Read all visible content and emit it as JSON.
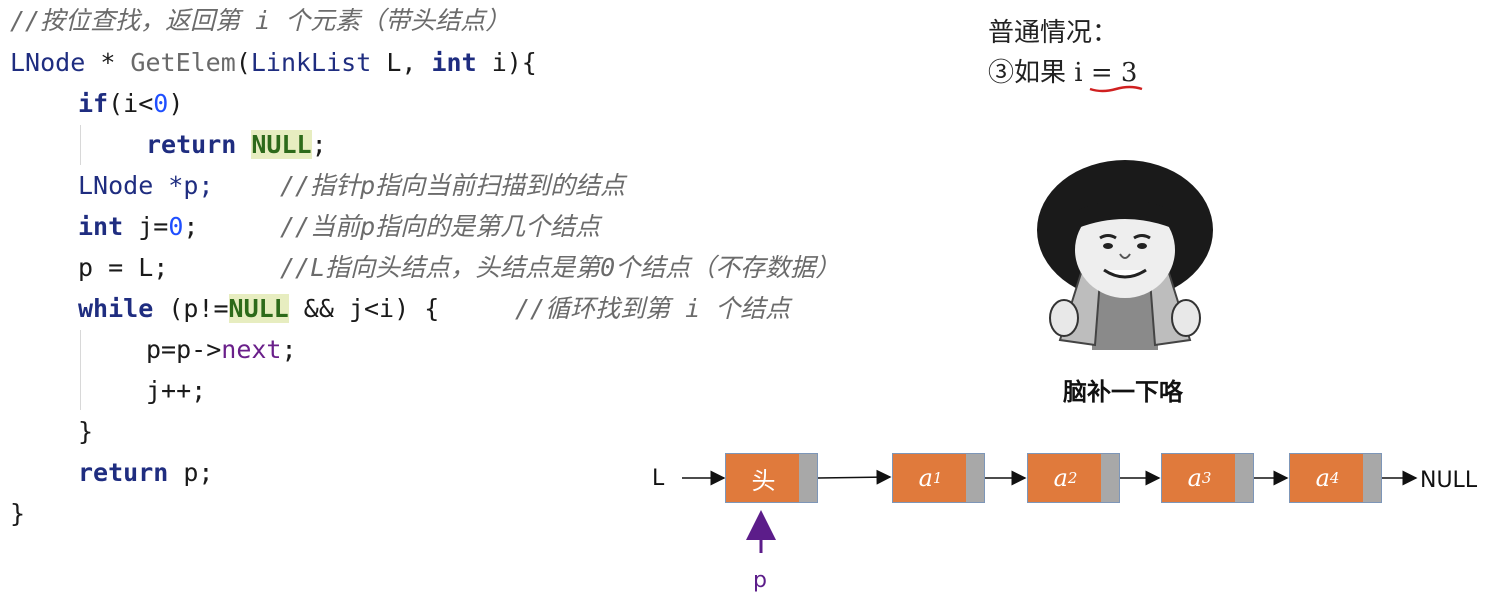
{
  "code": {
    "comment_title": "//按位查找，返回第 i 个元素（带头结点）",
    "sig_type": "LNode",
    "sig_star": " * ",
    "sig_fn": "GetElem",
    "sig_open": "(",
    "sig_param_type": "LinkList",
    "sig_param_L": " L, ",
    "sig_int": "int",
    "sig_rest": " i){",
    "if_kw": "if",
    "if_cond1": "(i<",
    "if_zero": "0",
    "if_close": ")",
    "return_kw": "return",
    "null_1": "NULL",
    "semicolon": ";",
    "decl_p": "LNode *p;",
    "comment_p": "//指针p指向当前扫描到的结点",
    "int_kw": "int",
    "decl_j1": " j=",
    "zero": "0",
    "decl_j2": ";",
    "comment_j": "//当前p指向的是第几个结点",
    "assign_p": "p = L;",
    "comment_L": "//L指向头结点，头结点是第0个结点（不存数据）",
    "while_kw": "while",
    "while_1": " (p!=",
    "null_2": "NULL",
    "while_2": " && j<i) {",
    "comment_while": "//循环找到第 i 个结点",
    "next_1": "p=p->",
    "next_field": "next",
    "next_2": ";",
    "incr": "j++;",
    "close_brace_inner": "}",
    "return_kw2": "return",
    "return_rest": " p;",
    "close_brace": "}"
  },
  "case": {
    "title": "普通情况：",
    "condition_prefix": "③如果 ",
    "condition": "i = 3"
  },
  "meme": {
    "caption": "脑补一下咯"
  },
  "diagram": {
    "L": "L",
    "head": "头",
    "nodes": [
      {
        "base": "a",
        "sub": "1"
      },
      {
        "base": "a",
        "sub": "2"
      },
      {
        "base": "a",
        "sub": "3"
      },
      {
        "base": "a",
        "sub": "4"
      }
    ],
    "null": "NULL",
    "pointer": "p",
    "colors": {
      "node_fill": "#e07a3c",
      "pointer_field": "#a8a8a8",
      "pointer_arrow": "#5c1d8a"
    }
  }
}
